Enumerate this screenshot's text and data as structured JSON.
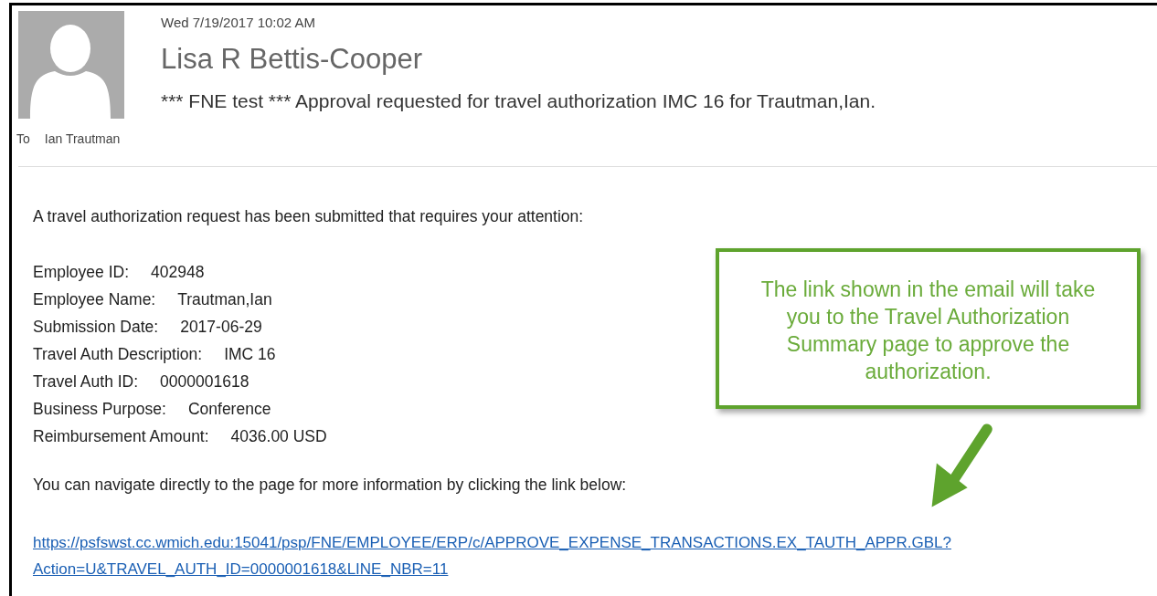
{
  "header": {
    "date": "Wed 7/19/2017 10:02 AM",
    "sender": "Lisa R Bettis-Cooper",
    "subject": "*** FNE test *** Approval requested for travel authorization IMC 16 for Trautman,Ian.",
    "to_label": "To",
    "to": "Ian Trautman"
  },
  "body": {
    "intro": "A travel authorization request has been submitted that requires your attention:",
    "fields": [
      {
        "label": "Employee ID:",
        "value": "402948"
      },
      {
        "label": "Employee Name:",
        "value": "Trautman,Ian"
      },
      {
        "label": "Submission Date:",
        "value": "2017-06-29"
      },
      {
        "label": "Travel Auth Description:",
        "value": "IMC 16"
      },
      {
        "label": "Travel Auth ID:",
        "value": "0000001618"
      },
      {
        "label": "Business Purpose:",
        "value": "Conference"
      },
      {
        "label": "Reimbursement Amount:",
        "value": "4036.00 USD"
      }
    ],
    "navigate": "You can navigate directly to the page for more information by clicking the link below:",
    "link_lines": [
      "https://psfswst.cc.wmich.edu:15041/psp/FNE/EMPLOYEE/ERP/c/APPROVE_EXPENSE_TRANSACTIONS.EX_TAUTH_APPR.GBL?",
      "Action=U&TRAVEL_AUTH_ID=0000001618&LINE_NBR=11"
    ]
  },
  "callout": {
    "text": "The link shown in the email will take you to the Travel Authorization Summary page to approve the authorization."
  }
}
